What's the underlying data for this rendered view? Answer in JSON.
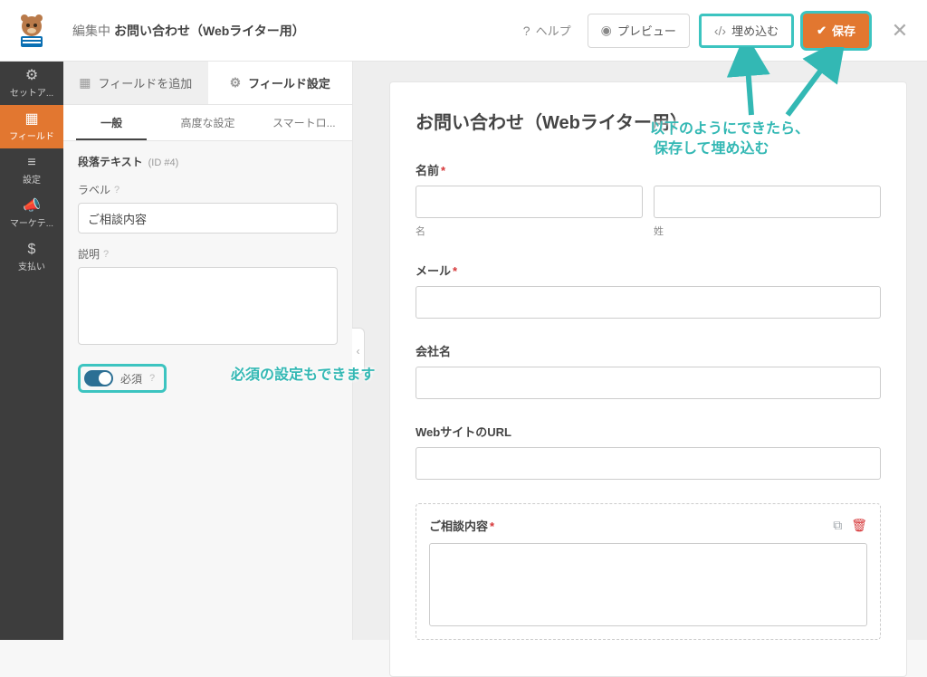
{
  "topbar": {
    "editing_label": "編集中",
    "form_name": "お問い合わせ（Webライター用）",
    "help": "ヘルプ",
    "preview": "プレビュー",
    "embed": "埋め込む",
    "save": "保存"
  },
  "rail": {
    "items": [
      {
        "icon": "⚙",
        "label": "セットア..."
      },
      {
        "icon": "▦",
        "label": "フィールド"
      },
      {
        "icon": "≡",
        "label": "設定"
      },
      {
        "icon": "📣",
        "label": "マーケテ..."
      },
      {
        "icon": "$",
        "label": "支払い"
      }
    ]
  },
  "panel": {
    "tabs": {
      "add": "フィールドを追加",
      "options": "フィールド設定"
    },
    "subtabs": {
      "general": "一般",
      "advanced": "高度な設定",
      "smart": "スマートロ..."
    },
    "field_type": "段落テキスト",
    "field_id": "(ID #4)",
    "label": {
      "caption": "ラベル",
      "value": "ご相談内容"
    },
    "description": {
      "caption": "説明"
    },
    "required": {
      "caption": "必須"
    }
  },
  "preview": {
    "title": "お問い合わせ（Webライター用）",
    "name": {
      "label": "名前",
      "first": "名",
      "last": "姓"
    },
    "mail": {
      "label": "メール"
    },
    "company": {
      "label": "会社名"
    },
    "url": {
      "label": "WebサイトのURL"
    },
    "body": {
      "label": "ご相談内容"
    }
  },
  "annotations": {
    "required": "必須の設定もできます",
    "save_line1": "以下のようにできたら、",
    "save_line2": "保存して埋め込む"
  }
}
